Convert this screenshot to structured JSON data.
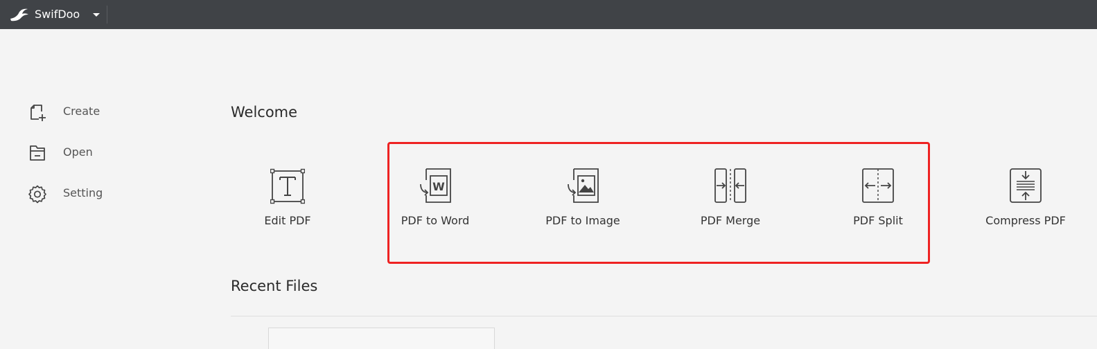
{
  "app": {
    "name": "SwifDoo"
  },
  "sidebar": {
    "items": [
      {
        "label": "Create",
        "icon": "create-file-icon"
      },
      {
        "label": "Open",
        "icon": "folder-icon"
      },
      {
        "label": "Setting",
        "icon": "gear-icon"
      }
    ]
  },
  "main": {
    "welcome_title": "Welcome",
    "recent_title": "Recent Files",
    "tools": [
      {
        "label": "Edit PDF",
        "icon": "edit-text-icon"
      },
      {
        "label": "PDF to Word",
        "icon": "pdf-to-word-icon"
      },
      {
        "label": "PDF to Image",
        "icon": "pdf-to-image-icon"
      },
      {
        "label": "PDF Merge",
        "icon": "merge-icon"
      },
      {
        "label": "PDF Split",
        "icon": "split-icon"
      },
      {
        "label": "Compress PDF",
        "icon": "compress-icon"
      }
    ]
  },
  "colors": {
    "titlebar": "#404347",
    "background": "#f4f4f4",
    "highlight": "#ee2222",
    "icon_stroke": "#444444"
  }
}
